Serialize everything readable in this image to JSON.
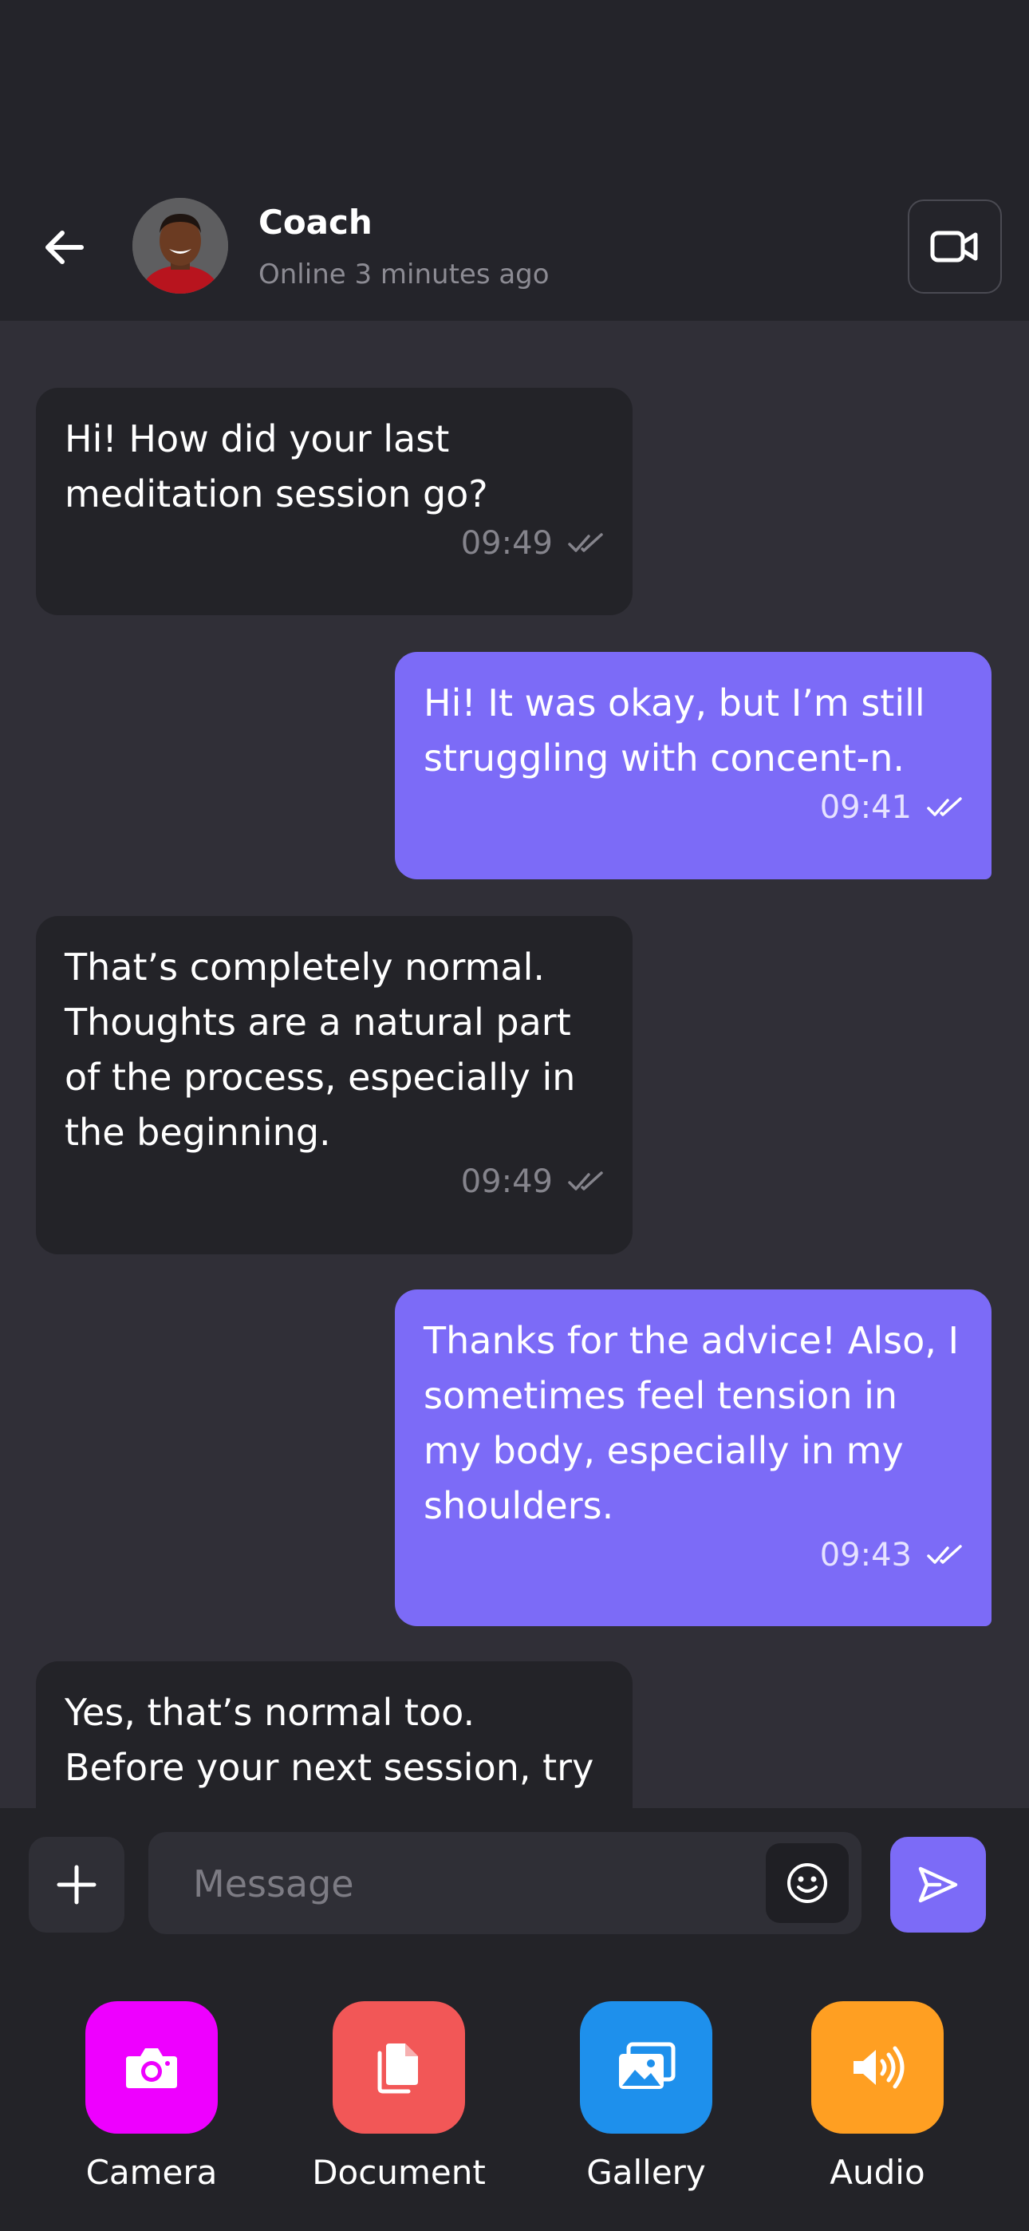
{
  "header": {
    "contact_name": "Coach",
    "status": "Online 3 minutes ago"
  },
  "messages": [
    {
      "direction": "in",
      "text": "Hi! How did your last meditation session go?",
      "time": "09:49"
    },
    {
      "direction": "out",
      "text": "Hi! It was okay, but I’m still struggling with concent-n.",
      "time": "09:41"
    },
    {
      "direction": "in",
      "text": "That’s completely normal. Thoughts are a natural part of the process, especially in the beginning.",
      "time": "09:49"
    },
    {
      "direction": "out",
      "text": "Thanks for the advice! Also, I sometimes feel tension in my body, especially in my shoulders.",
      "time": "09:43"
    },
    {
      "direction": "in",
      "text": "Yes, that’s normal too. Before your next session, try",
      "time": ""
    }
  ],
  "composer": {
    "placeholder": "Message"
  },
  "attachments": [
    {
      "label": "Camera",
      "color": "#EE00FF",
      "icon": "camera-icon"
    },
    {
      "label": "Document",
      "color": "#F25757",
      "icon": "document-icon"
    },
    {
      "label": "Gallery",
      "color": "#1E90EC",
      "icon": "gallery-icon"
    },
    {
      "label": "Audio",
      "color": "#FF9F22",
      "icon": "audio-icon"
    }
  ],
  "colors": {
    "background": "#302F37",
    "header": "#24242A",
    "incoming_bubble": "#232328",
    "outgoing_bubble": "#7C6BF7"
  }
}
